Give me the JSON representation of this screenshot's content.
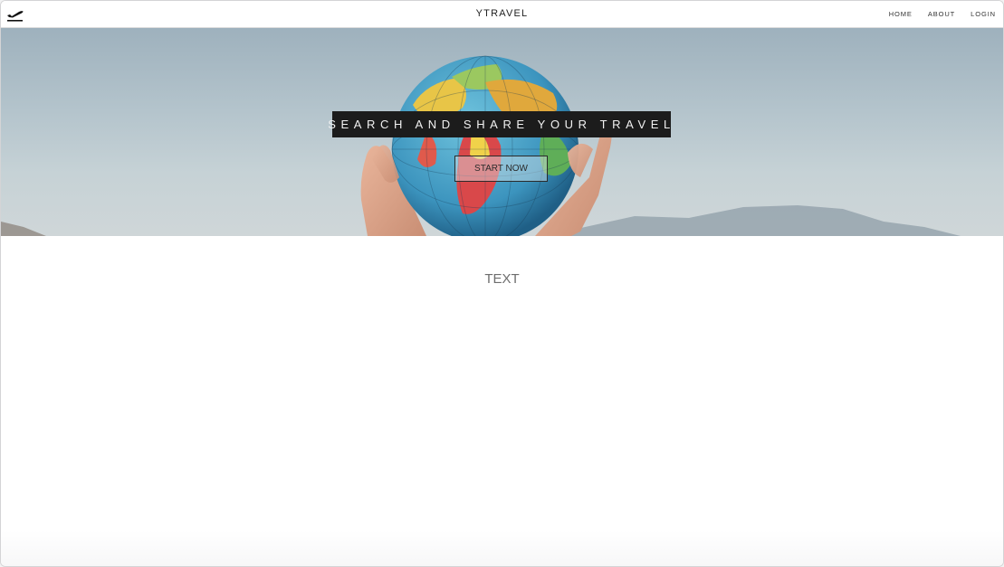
{
  "navbar": {
    "logo_icon": "airplane-departure-icon",
    "brand": "YTRAVEL",
    "links": [
      {
        "label": "HOME"
      },
      {
        "label": "ABOUT"
      },
      {
        "label": "LOGIN"
      }
    ]
  },
  "hero": {
    "title": "SEARCH AND SHARE YOUR TRAVEL",
    "cta_label": "START NOW",
    "background_image": "hands-holding-globe-photo"
  },
  "main": {
    "text": "TEXT"
  },
  "colors": {
    "title_bg": "#1c1c1c",
    "title_text": "#f1f1f1",
    "body_text": "#6e6e6e"
  }
}
